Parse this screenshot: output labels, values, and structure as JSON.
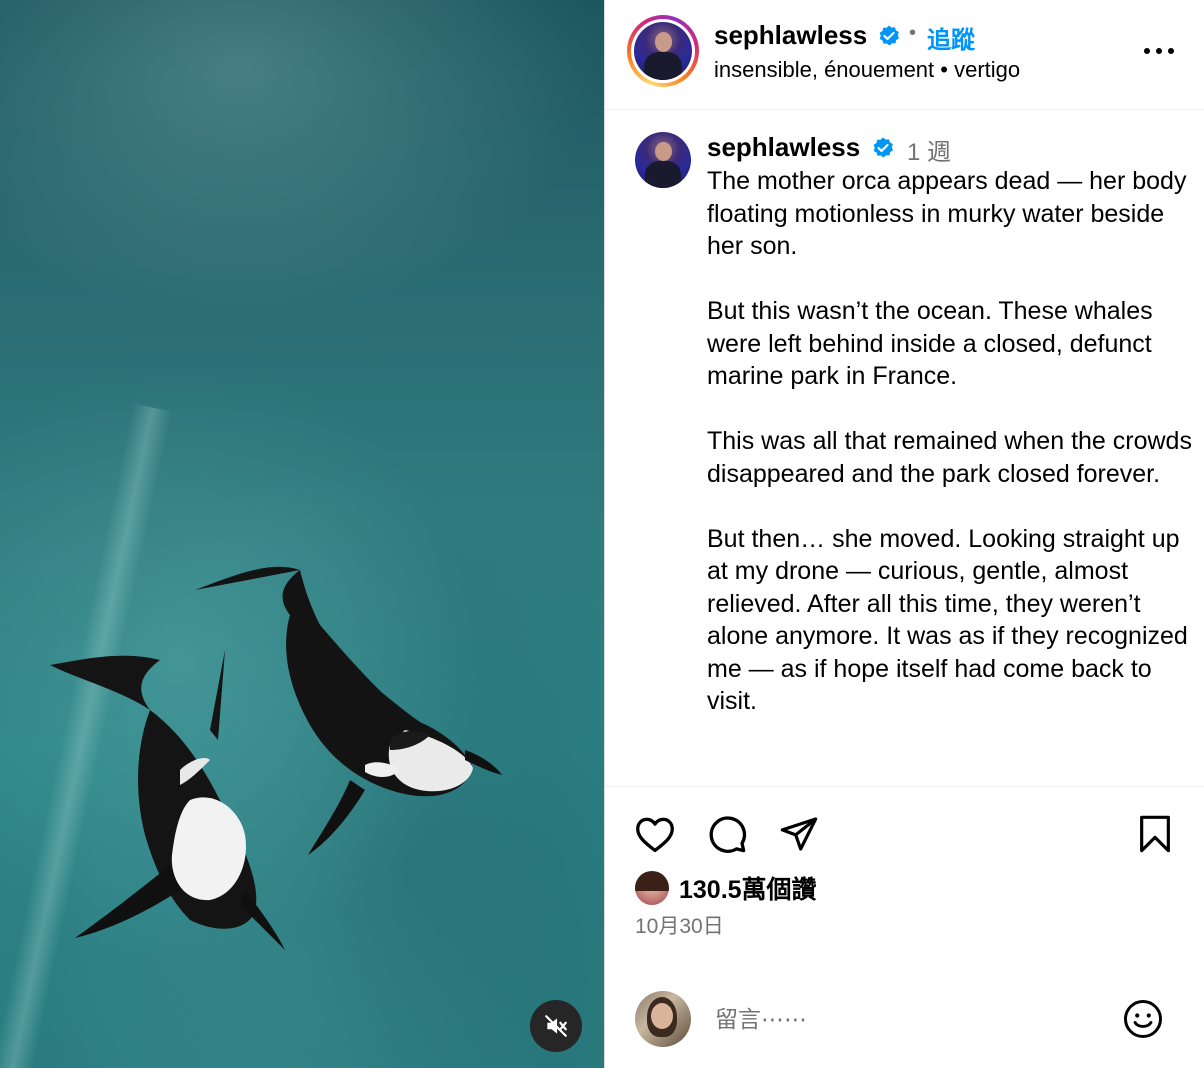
{
  "media": {
    "type": "video",
    "mute_icon": "volume-muted-icon"
  },
  "post": {
    "username": "sephlawless",
    "verified": true,
    "follow_label": "追蹤",
    "separator": "•",
    "audio": "insensible, énouement • vertigo",
    "more_icon": "more-horizontal-icon"
  },
  "caption": {
    "username": "sephlawless",
    "time": "1 週",
    "text": "The mother orca appears dead — her body floating motionless in murky water beside her son.\n\nBut this wasn’t the ocean. These whales were left behind inside a closed, defunct marine park in France.\n\nThis was all that remained when the crowds disappeared and the park closed forever.\n\nBut then… she moved. Looking straight up at my drone — curious, gentle, almost relieved. After all this time, they weren’t alone anymore. It was as if they recognized me — as if hope itself had come back to visit."
  },
  "actions": {
    "like_icon": "heart-icon",
    "comment_icon": "comment-icon",
    "share_icon": "share-icon",
    "save_icon": "bookmark-icon"
  },
  "likes": {
    "count_label": "130.5萬個讚"
  },
  "date": "10月30日",
  "comment": {
    "placeholder": "留言⋯⋯",
    "emoji_icon": "emoji-icon"
  },
  "colors": {
    "accent": "#0095f6",
    "secondary_text": "#737373",
    "verified": "#0095f6"
  }
}
